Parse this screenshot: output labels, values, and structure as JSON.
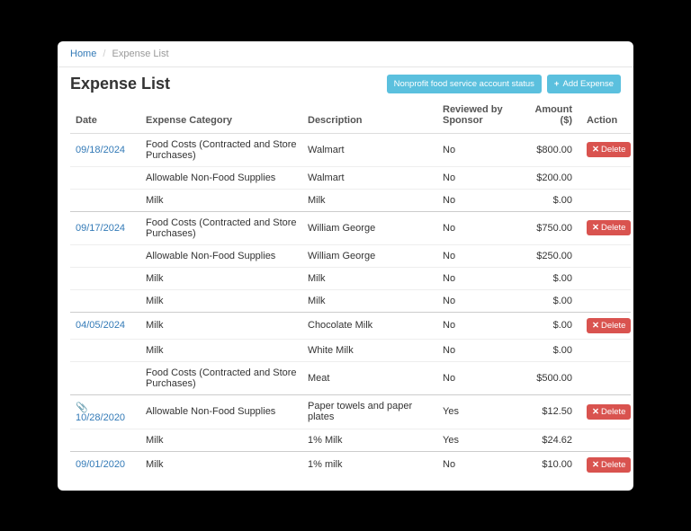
{
  "breadcrumb": {
    "home": "Home",
    "current": "Expense List"
  },
  "title": "Expense List",
  "buttons": {
    "account_status": "Nonprofit food service account status",
    "add_expense": "Add Expense",
    "delete": "Delete"
  },
  "headers": {
    "date": "Date",
    "category": "Expense Category",
    "description": "Description",
    "reviewed": "Reviewed by Sponsor",
    "amount": "Amount ($)",
    "action": "Action"
  },
  "groups": [
    {
      "date": "09/18/2024",
      "attachment": false,
      "rows": [
        {
          "category": "Food Costs (Contracted and Store Purchases)",
          "description": "Walmart",
          "reviewed": "No",
          "amount": "$800.00"
        },
        {
          "category": "Allowable Non-Food Supplies",
          "description": "Walmart",
          "reviewed": "No",
          "amount": "$200.00"
        },
        {
          "category": "Milk",
          "description": "Milk",
          "reviewed": "No",
          "amount": "$.00"
        }
      ]
    },
    {
      "date": "09/17/2024",
      "attachment": false,
      "rows": [
        {
          "category": "Food Costs (Contracted and Store Purchases)",
          "description": "William George",
          "reviewed": "No",
          "amount": "$750.00"
        },
        {
          "category": "Allowable Non-Food Supplies",
          "description": "William George",
          "reviewed": "No",
          "amount": "$250.00"
        },
        {
          "category": "Milk",
          "description": "Milk",
          "reviewed": "No",
          "amount": "$.00"
        },
        {
          "category": "Milk",
          "description": "Milk",
          "reviewed": "No",
          "amount": "$.00"
        }
      ]
    },
    {
      "date": "04/05/2024",
      "attachment": false,
      "rows": [
        {
          "category": "Milk",
          "description": "Chocolate Milk",
          "reviewed": "No",
          "amount": "$.00"
        },
        {
          "category": "Milk",
          "description": "White Milk",
          "reviewed": "No",
          "amount": "$.00"
        },
        {
          "category": "Food Costs (Contracted and Store Purchases)",
          "description": "Meat",
          "reviewed": "No",
          "amount": "$500.00"
        }
      ]
    },
    {
      "date": "10/28/2020",
      "attachment": true,
      "rows": [
        {
          "category": "Allowable Non-Food Supplies",
          "description": "Paper towels and paper plates",
          "reviewed": "Yes",
          "amount": "$12.50"
        },
        {
          "category": "Milk",
          "description": "1% Milk",
          "reviewed": "Yes",
          "amount": "$24.62"
        }
      ]
    },
    {
      "date": "09/01/2020",
      "attachment": false,
      "rows": [
        {
          "category": "Milk",
          "description": "1% milk",
          "reviewed": "No",
          "amount": "$10.00"
        }
      ]
    }
  ]
}
